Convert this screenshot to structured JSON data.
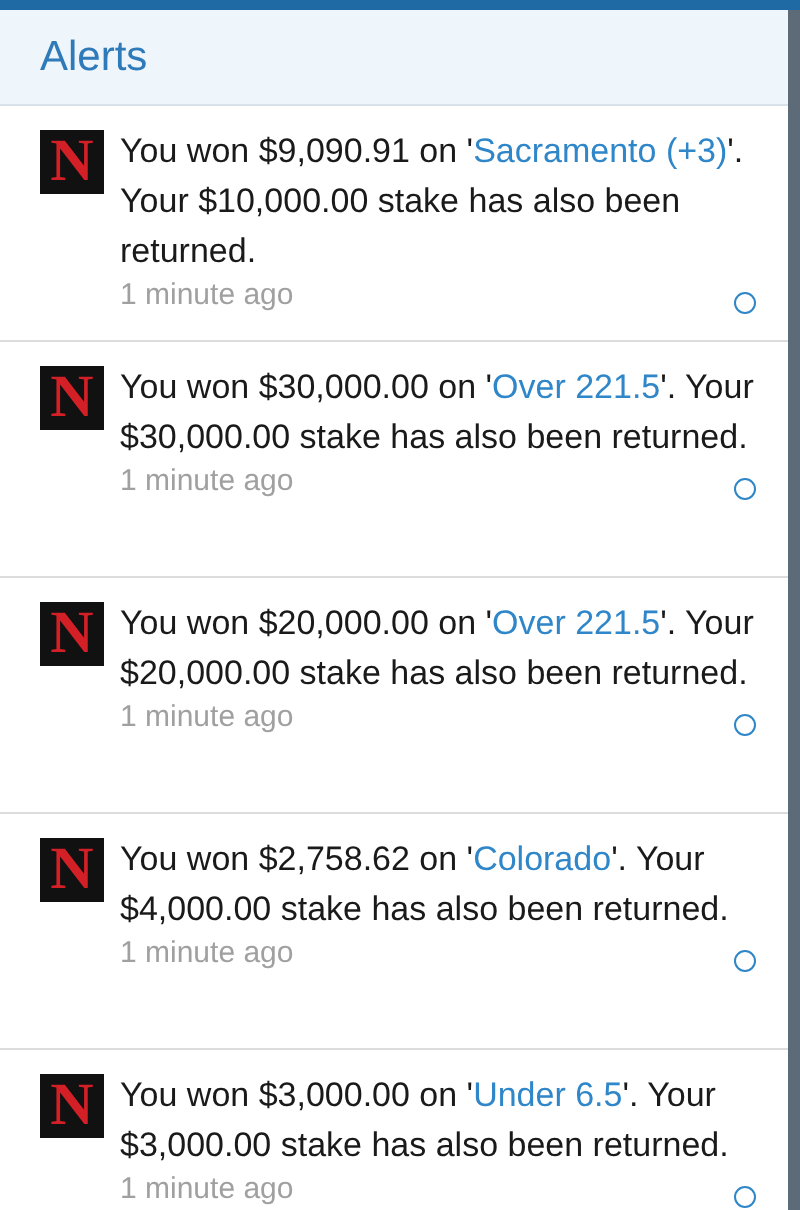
{
  "header": {
    "title": "Alerts"
  },
  "alerts": [
    {
      "logo": "N",
      "prefix": "You won $9,090.91 on '",
      "link": "Sacramento (+3)",
      "suffix": "'. Your $10,000.00 stake has also been returned.",
      "time": "1 minute ago",
      "unread": true
    },
    {
      "logo": "N",
      "prefix": "You won $30,000.00 on '",
      "link": "Over 221.5",
      "suffix": "'. Your $30,000.00 stake has also been returned.",
      "time": "1 minute ago",
      "unread": true
    },
    {
      "logo": "N",
      "prefix": "You won $20,000.00 on '",
      "link": "Over 221.5",
      "suffix": "'. Your $20,000.00 stake has also been returned.",
      "time": "1 minute ago",
      "unread": true
    },
    {
      "logo": "N",
      "prefix": "You won $2,758.62 on '",
      "link": "Colorado",
      "suffix": "'. Your $4,000.00 stake has also been returned.",
      "time": "1 minute ago",
      "unread": true
    },
    {
      "logo": "N",
      "prefix": "You won $3,000.00 on '",
      "link": "Under 6.5",
      "suffix": "'. Your $3,000.00 stake has also been returned.",
      "time": "1 minute ago",
      "unread": true
    }
  ]
}
